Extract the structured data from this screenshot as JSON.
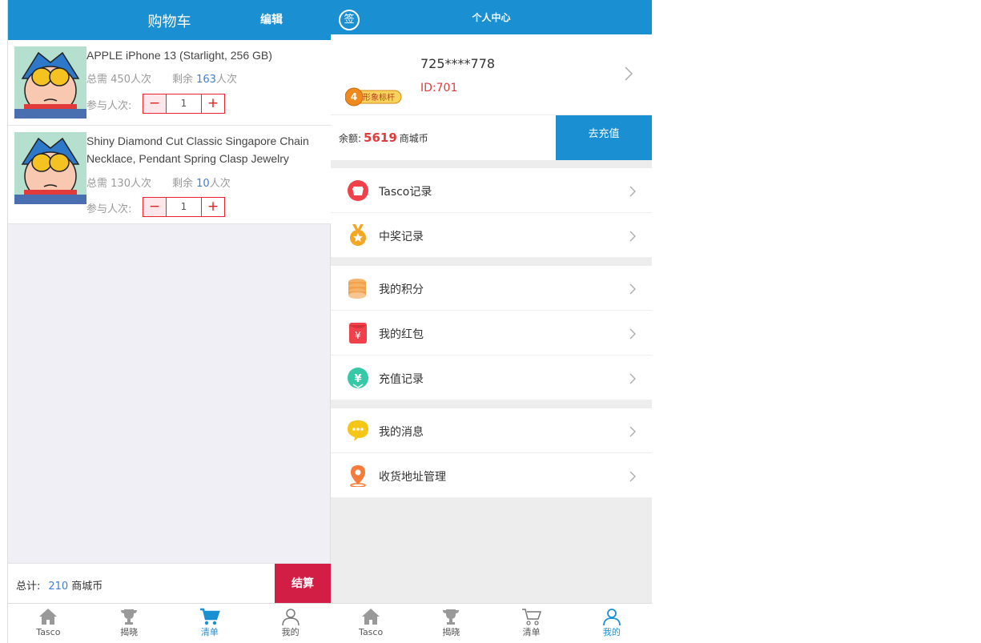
{
  "cart": {
    "title": "购物车",
    "edit_label": "编辑",
    "items": [
      {
        "name": "APPLE iPhone 13 (Starlight, 256 GB)",
        "total_label": "总需",
        "total_value": "450人次",
        "remaining_label": "剩余",
        "remaining_value": "163",
        "remaining_unit": "人次",
        "qty_label": "参与人次:",
        "qty_value": "1"
      },
      {
        "name": "Shiny Diamond Cut Classic Singapore Chain Necklace, Pendant Spring Clasp Jewelry",
        "total_label": "总需",
        "total_value": "130人次",
        "remaining_label": "剩余",
        "remaining_value": "10",
        "remaining_unit": "人次",
        "qty_label": "参与人次:",
        "qty_value": "1"
      }
    ],
    "total_label": "总计:",
    "total_amount": "210",
    "total_currency": "商城币",
    "checkout_label": "结算"
  },
  "tabs_left": [
    {
      "label": "Tasco",
      "icon": "home-icon",
      "active": false
    },
    {
      "label": "揭晓",
      "icon": "trophy-icon",
      "active": false
    },
    {
      "label": "清单",
      "icon": "cart-icon",
      "active": true
    },
    {
      "label": "我的",
      "icon": "user-icon",
      "active": false
    }
  ],
  "profile": {
    "title": "个人中心",
    "sign_label": "签",
    "phone": "725****778",
    "id_text": "ID:701",
    "badge_level": "4",
    "badge_text": "形象标杆",
    "balance_label": "余额:",
    "balance_value": "5619",
    "balance_unit": "商城币",
    "recharge_label": "去充值",
    "menu": [
      {
        "label": "Tasco记录",
        "icon": "record-icon"
      },
      {
        "label": "中奖记录",
        "icon": "medal-icon"
      },
      {
        "label": "我的积分",
        "icon": "coins-icon"
      },
      {
        "label": "我的红包",
        "icon": "red-envelope-icon"
      },
      {
        "label": "充值记录",
        "icon": "recharge-icon"
      },
      {
        "label": "我的消息",
        "icon": "message-icon"
      },
      {
        "label": "收货地址管理",
        "icon": "location-icon"
      }
    ]
  },
  "tabs_right": [
    {
      "label": "Tasco",
      "icon": "home-icon",
      "active": false
    },
    {
      "label": "揭晓",
      "icon": "trophy-icon",
      "active": false
    },
    {
      "label": "清单",
      "icon": "cart-icon",
      "active": false
    },
    {
      "label": "我的",
      "icon": "user-icon",
      "active": true
    }
  ],
  "colors": {
    "header": "#1a8fd2",
    "checkout": "#d21d45",
    "price_red": "#e23b3b",
    "link_blue": "#3e7ed6"
  }
}
